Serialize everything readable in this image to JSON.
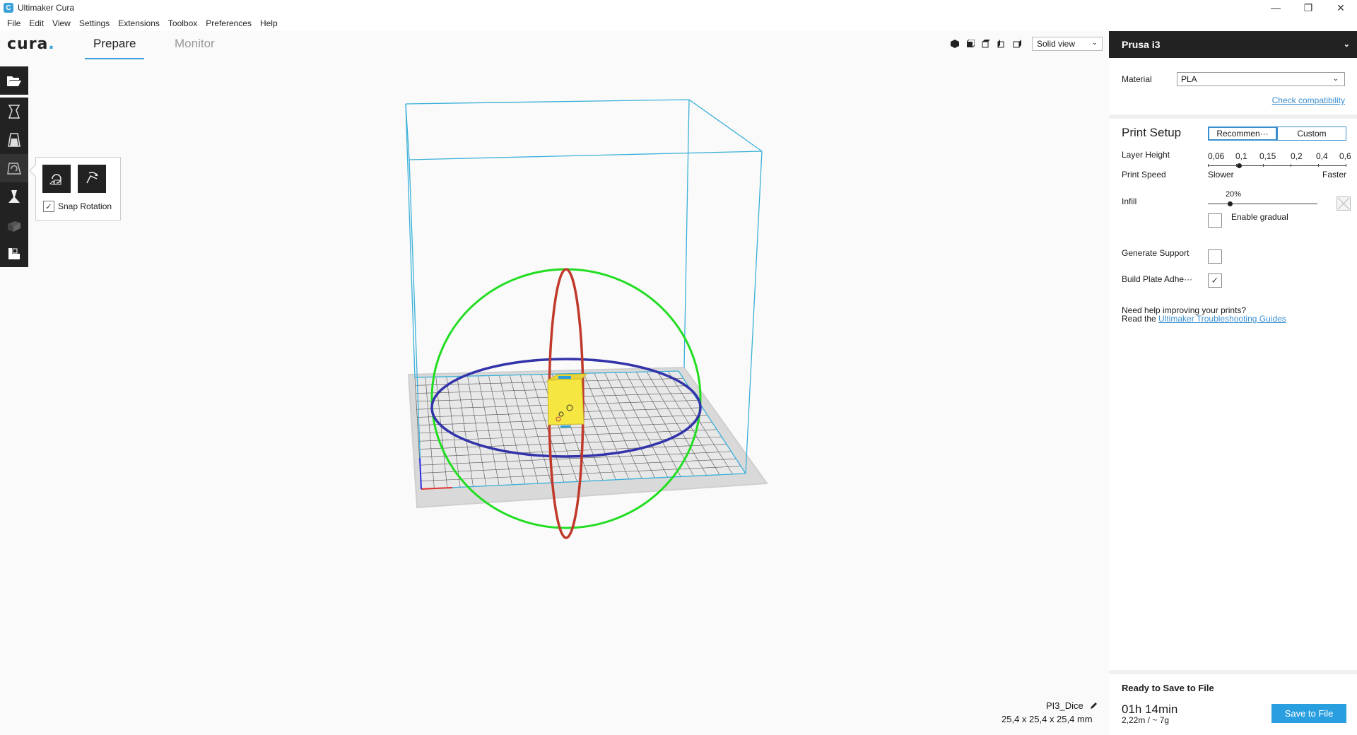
{
  "window": {
    "title": "Ultimaker Cura",
    "app_icon_letter": "C",
    "minimize": "—",
    "maximize": "❐",
    "close": "✕"
  },
  "menu": [
    "File",
    "Edit",
    "View",
    "Settings",
    "Extensions",
    "Toolbox",
    "Preferences",
    "Help"
  ],
  "header": {
    "logo_main": "cura",
    "logo_dot": ".",
    "tabs": [
      {
        "label": "Prepare",
        "active": true
      },
      {
        "label": "Monitor",
        "active": false
      }
    ],
    "view_icons": [
      "3d-view-icon",
      "front-view-icon",
      "top-view-icon",
      "left-view-icon",
      "right-view-icon"
    ],
    "view_mode": "Solid view"
  },
  "left_toolbar": {
    "open_icon": "folder-open-icon",
    "tools": [
      "move-tool-icon",
      "scale-tool-icon",
      "rotate-tool-icon",
      "mirror-tool-icon",
      "per-model-settings-icon",
      "support-blocker-icon"
    ],
    "active_tool": "rotate-tool-icon"
  },
  "rotate_panel": {
    "buttons": [
      "reset-rotation-icon",
      "lay-flat-icon"
    ],
    "snap_label": "Snap Rotation",
    "snap_checked": true
  },
  "object": {
    "name": "PI3_Dice",
    "dimensions": "25,4 x 25,4 x 25,4 mm"
  },
  "sidebar": {
    "machine": "Prusa i3",
    "material_label": "Material",
    "material_value": "PLA",
    "check_compat": "Check compatibility",
    "print_setup_title": "Print Setup",
    "mode_recommended": "Recommen···",
    "mode_custom": "Custom",
    "layer_height_label": "Layer Height",
    "layer_heights": [
      "0,06",
      "0,1",
      "0,15",
      "0,2",
      "0,4",
      "0,6"
    ],
    "layer_height_selected_index": 1,
    "print_speed_label": "Print Speed",
    "speed_slower": "Slower",
    "speed_faster": "Faster",
    "infill_label": "Infill",
    "infill_value": "20%",
    "infill_fraction": 0.2,
    "enable_gradual_label": "Enable gradual",
    "enable_gradual_checked": false,
    "generate_support_label": "Generate Support",
    "generate_support_checked": false,
    "adhesion_label": "Build Plate Adhe···",
    "adhesion_checked": true,
    "help_line1": "Need help improving your prints?",
    "help_line2_prefix": "Read the ",
    "help_link": "Ultimaker Troubleshooting Guides",
    "ready_label": "Ready to Save to File",
    "print_time": "01h 14min",
    "print_material": "2,22m / ~ 7g",
    "save_button": "Save to File"
  },
  "colors": {
    "accent": "#3aa0d8",
    "toolbar_dark": "#222222",
    "save_button": "#2a9fe0",
    "x_ring": "#c0392b",
    "y_ring": "#22dd22",
    "z_ring": "#3333aa",
    "build_volume": "#3ab0d8",
    "model": "#f5e642"
  }
}
